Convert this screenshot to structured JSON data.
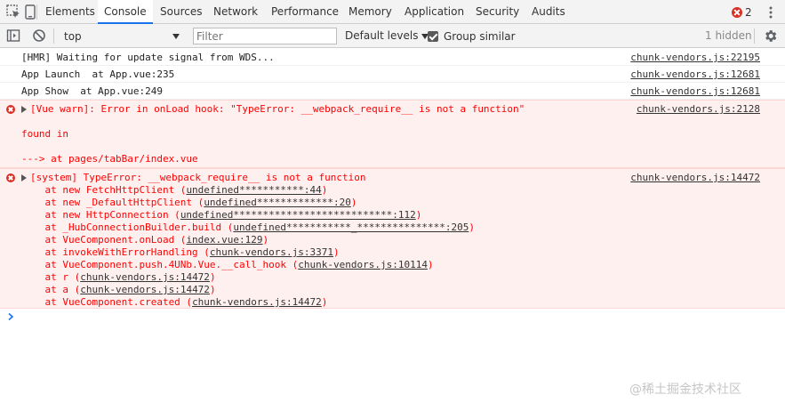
{
  "tabs": [
    "Elements",
    "Console",
    "Sources",
    "Network",
    "Performance",
    "Memory",
    "Application",
    "Security",
    "Audits"
  ],
  "active_tab": "Console",
  "error_count": "2",
  "toolbar": {
    "context": "top",
    "filter_placeholder": "Filter",
    "levels_label": "Default levels",
    "group_similar_label": "Group similar",
    "hidden_label": "1 hidden"
  },
  "messages": [
    {
      "type": "log",
      "text": "[HMR] Waiting for update signal from WDS...",
      "source": "chunk-vendors.js:22195"
    },
    {
      "type": "log",
      "text": "App Launch  at App.vue:235",
      "source": "chunk-vendors.js:12681"
    },
    {
      "type": "log",
      "text": "App Show  at App.vue:249",
      "source": "chunk-vendors.js:12681"
    }
  ],
  "vue_warn": {
    "line1": "[Vue warn]: Error in onLoad hook: \"TypeError: __webpack_require__ is not a function\"",
    "line2": "found in",
    "line3": "---> at pages/tabBar/index.vue",
    "source": "chunk-vendors.js:2128"
  },
  "system_error": {
    "head": "[system] TypeError: __webpack_require__ is not a function",
    "source": "chunk-vendors.js:14472",
    "frames": [
      {
        "prefix": "    at new FetchHttpClient (",
        "link": "undefined***********:44",
        "suffix": ")"
      },
      {
        "prefix": "    at new _DefaultHttpClient (",
        "link": "undefined*************:20",
        "suffix": ")"
      },
      {
        "prefix": "    at new HttpConnection (",
        "link": "undefined***************************:112",
        "suffix": ")"
      },
      {
        "prefix": "    at _HubConnectionBuilder.build (",
        "link": "undefined***********_***************:205",
        "suffix": ")"
      },
      {
        "prefix": "    at VueComponent.onLoad (",
        "link": "index.vue:129",
        "suffix": ")"
      },
      {
        "prefix": "    at invokeWithErrorHandling (",
        "link": "chunk-vendors.js:3371",
        "suffix": ")"
      },
      {
        "prefix": "    at VueComponent.push.4UNb.Vue.__call_hook (",
        "link": "chunk-vendors.js:10114",
        "suffix": ")"
      },
      {
        "prefix": "    at r (",
        "link": "chunk-vendors.js:14472",
        "suffix": ")"
      },
      {
        "prefix": "    at a (",
        "link": "chunk-vendors.js:14472",
        "suffix": ")"
      },
      {
        "prefix": "    at VueComponent.created (",
        "link": "chunk-vendors.js:14472",
        "suffix": ")"
      }
    ]
  },
  "watermark": "@稀土掘金技术社区",
  "colors": {
    "error_text": "#ff0000",
    "error_bg": "#fff0f0",
    "accent": "#1a73e8"
  }
}
